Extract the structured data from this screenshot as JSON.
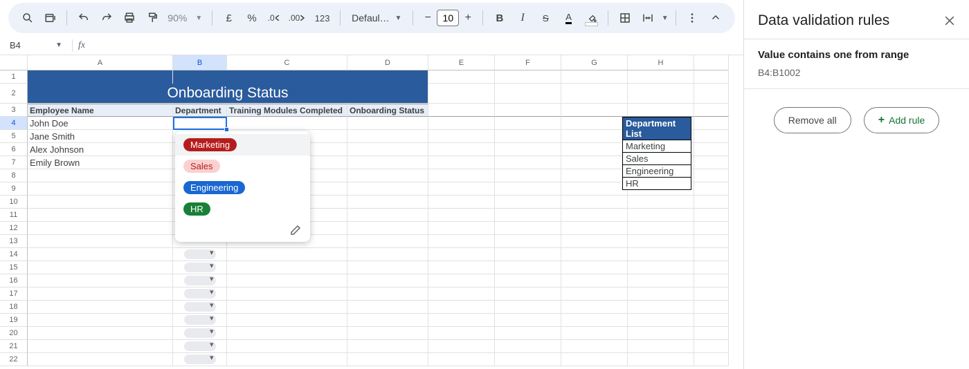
{
  "toolbar": {
    "zoom": "90%",
    "currency": "£",
    "percent": "%",
    "dec_less": ".0",
    "dec_more": ".00",
    "num_fmt": "123",
    "font": "Defaul…",
    "font_size": "10",
    "bold": "B",
    "italic": "I",
    "strike": "S",
    "text_color": "A"
  },
  "name_box": "B4",
  "sheet": {
    "columns": [
      "A",
      "B",
      "C",
      "D",
      "E",
      "F",
      "G",
      "H"
    ],
    "title": "Onboarding Status",
    "headers": {
      "A": "Employee Name",
      "B": "Department",
      "C": "Training Modules Completed",
      "D": "Onboarding Status"
    },
    "employees": [
      "John Doe",
      "Jane Smith",
      "Alex Johnson",
      "Emily Brown"
    ],
    "dept_list_header": "Department List",
    "dept_list": [
      "Marketing",
      "Sales",
      "Engineering",
      "HR"
    ]
  },
  "dropdown": {
    "options": [
      {
        "label": "Marketing",
        "color": "red"
      },
      {
        "label": "Sales",
        "color": "pink"
      },
      {
        "label": "Engineering",
        "color": "blue"
      },
      {
        "label": "HR",
        "color": "green"
      }
    ]
  },
  "sidepanel": {
    "title": "Data validation rules",
    "rule_title": "Value contains one from range",
    "rule_range": "B4:B1002",
    "remove_all": "Remove all",
    "add_rule": "Add rule"
  }
}
